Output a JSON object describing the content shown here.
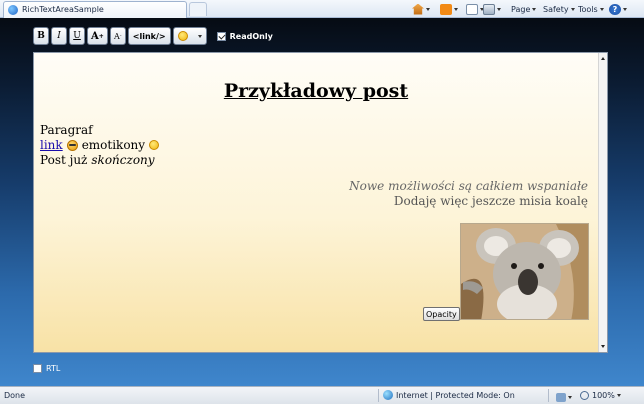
{
  "browser": {
    "tab_title": "RichTextAreaSample",
    "commands": {
      "page": "Page",
      "safety": "Safety",
      "tools": "Tools"
    }
  },
  "toolbar": {
    "bold": "B",
    "italic": "I",
    "underline": "U",
    "grow_font": "A",
    "shrink_font": "A",
    "link": "<link/>",
    "readonly_label": "ReadOnly",
    "readonly_checked": true
  },
  "editor": {
    "title": "Przykładowy post",
    "paragraph": "Paragraf",
    "link_text": "link",
    "emoticons_text": "emotikony",
    "post_prefix": "Post już",
    "post_italic": "skończony",
    "right_italic": "Nowe możliwości są całkiem wspaniałe",
    "right_normal": "Dodaję więc jeszcze misia koalę",
    "opacity_button": "Opacity"
  },
  "rtl": {
    "label": "RTL",
    "checked": false
  },
  "status": {
    "left": "Done",
    "zone": "Internet | Protected Mode: On",
    "zoom": "100%"
  },
  "icons": {
    "tab": "ie-icon",
    "home": "home-icon",
    "feeds": "feeds-icon",
    "mail": "mail-icon",
    "print": "print-icon",
    "help": "help-icon",
    "emoticon": "smiley-icon",
    "zone": "globe-icon"
  },
  "colors": {
    "link": "#1a0dab",
    "editor_gradient_top": "#fffdf7",
    "editor_gradient_bottom": "#f8e2a6",
    "background_top": "#060b13",
    "background_bottom": "#3f86cc"
  }
}
